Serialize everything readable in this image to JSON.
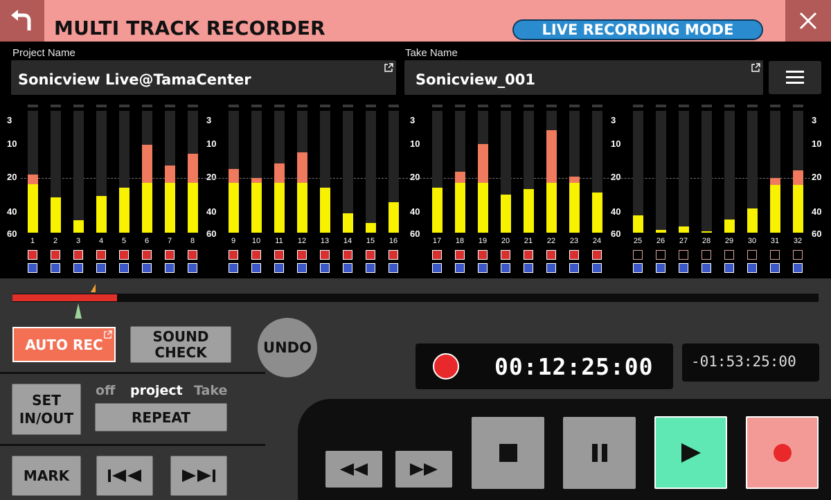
{
  "header": {
    "title": "MULTI TRACK RECORDER",
    "mode": "LIVE RECORDING MODE",
    "back_icon": "back-arrow-icon",
    "close_icon": "close-icon"
  },
  "project": {
    "label": "Project Name",
    "value": "Sonicview Live@TamaCenter"
  },
  "take": {
    "label": "Take Name",
    "value": "Sonicview_001"
  },
  "meters": {
    "scale": [
      "3",
      "10",
      "20",
      "40",
      "60"
    ],
    "channels": [
      {
        "num": "1",
        "level": 0.4,
        "peak": 0.48,
        "rec": true
      },
      {
        "num": "2",
        "level": 0.29,
        "peak": 0.29,
        "rec": true
      },
      {
        "num": "3",
        "level": 0.1,
        "peak": 0.1,
        "rec": true
      },
      {
        "num": "4",
        "level": 0.3,
        "peak": 0.3,
        "rec": true
      },
      {
        "num": "5",
        "level": 0.37,
        "peak": 0.37,
        "rec": true
      },
      {
        "num": "6",
        "level": 0.41,
        "peak": 0.72,
        "rec": true
      },
      {
        "num": "7",
        "level": 0.41,
        "peak": 0.55,
        "rec": true
      },
      {
        "num": "8",
        "level": 0.41,
        "peak": 0.65,
        "rec": true
      },
      {
        "num": "9",
        "level": 0.41,
        "peak": 0.52,
        "rec": true
      },
      {
        "num": "10",
        "level": 0.41,
        "peak": 0.45,
        "rec": true
      },
      {
        "num": "11",
        "level": 0.41,
        "peak": 0.57,
        "rec": true
      },
      {
        "num": "12",
        "level": 0.41,
        "peak": 0.66,
        "rec": true
      },
      {
        "num": "13",
        "level": 0.37,
        "peak": 0.37,
        "rec": true
      },
      {
        "num": "14",
        "level": 0.16,
        "peak": 0.16,
        "rec": true
      },
      {
        "num": "15",
        "level": 0.08,
        "peak": 0.08,
        "rec": true
      },
      {
        "num": "16",
        "level": 0.25,
        "peak": 0.25,
        "rec": true
      },
      {
        "num": "17",
        "level": 0.37,
        "peak": 0.37,
        "rec": true
      },
      {
        "num": "18",
        "level": 0.41,
        "peak": 0.5,
        "rec": true
      },
      {
        "num": "19",
        "level": 0.41,
        "peak": 0.73,
        "rec": true
      },
      {
        "num": "20",
        "level": 0.31,
        "peak": 0.31,
        "rec": true
      },
      {
        "num": "21",
        "level": 0.36,
        "peak": 0.36,
        "rec": true
      },
      {
        "num": "22",
        "level": 0.41,
        "peak": 0.84,
        "rec": true
      },
      {
        "num": "23",
        "level": 0.41,
        "peak": 0.46,
        "rec": true
      },
      {
        "num": "24",
        "level": 0.33,
        "peak": 0.33,
        "rec": true
      },
      {
        "num": "25",
        "level": 0.14,
        "peak": 0.14,
        "rec": false
      },
      {
        "num": "26",
        "level": 0.02,
        "peak": 0.02,
        "rec": false
      },
      {
        "num": "27",
        "level": 0.05,
        "peak": 0.05,
        "rec": false
      },
      {
        "num": "28",
        "level": 0.01,
        "peak": 0.01,
        "rec": false
      },
      {
        "num": "29",
        "level": 0.11,
        "peak": 0.11,
        "rec": false
      },
      {
        "num": "30",
        "level": 0.2,
        "peak": 0.2,
        "rec": false
      },
      {
        "num": "31",
        "level": 0.39,
        "peak": 0.45,
        "rec": false
      },
      {
        "num": "32",
        "level": 0.39,
        "peak": 0.51,
        "rec": false
      }
    ]
  },
  "timeline": {
    "progress": 0.13
  },
  "buttons": {
    "auto_rec": "AUTO REC",
    "sound_check": [
      "SOUND",
      "CHECK"
    ],
    "undo": "UNDO",
    "set_in_out": [
      "SET",
      "IN/OUT"
    ],
    "repeat": "REPEAT",
    "mark": "MARK"
  },
  "repeat_options": {
    "off": "off",
    "project": "project",
    "take": "Take",
    "selected": "project"
  },
  "counter": {
    "elapsed": "00:12:25:00",
    "remaining": "-01:53:25:00"
  },
  "colors": {
    "header": "#f49a96",
    "accent_blue": "#2a8ccf",
    "meter_yellow": "#f8f200",
    "meter_peak": "#f07a5e",
    "rec_red": "#e8282a",
    "play_green": "#5fe8b4",
    "rec_pink": "#f49a96"
  }
}
